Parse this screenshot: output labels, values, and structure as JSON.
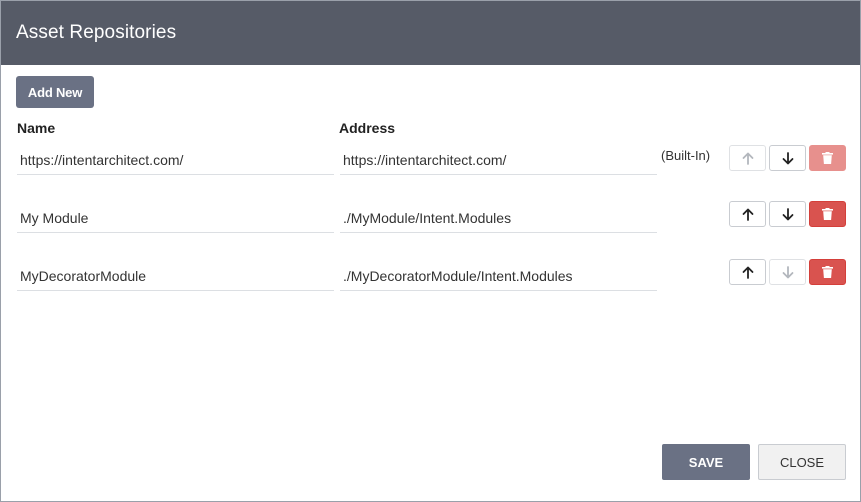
{
  "dialog": {
    "title": "Asset Repositories",
    "add_label": "Add New",
    "columns": {
      "name": "Name",
      "address": "Address"
    },
    "save_label": "SAVE",
    "close_label": "CLOSE"
  },
  "repositories": [
    {
      "name": "https://intentarchitect.com/",
      "address": "https://intentarchitect.com/",
      "tag": "(Built-In)",
      "up_enabled": false,
      "down_enabled": true,
      "delete_enabled": false
    },
    {
      "name": "My Module",
      "address": "./MyModule/Intent.Modules",
      "tag": "",
      "up_enabled": true,
      "down_enabled": true,
      "delete_enabled": true
    },
    {
      "name": "MyDecoratorModule",
      "address": "./MyDecoratorModule/Intent.Modules",
      "tag": "",
      "up_enabled": true,
      "down_enabled": false,
      "delete_enabled": true
    }
  ],
  "icons": {
    "up": "arrow-up-icon",
    "down": "arrow-down-icon",
    "delete": "trash-icon"
  },
  "colors": {
    "header": "#565b67",
    "primary": "#6a7184",
    "danger": "#d9534f"
  }
}
